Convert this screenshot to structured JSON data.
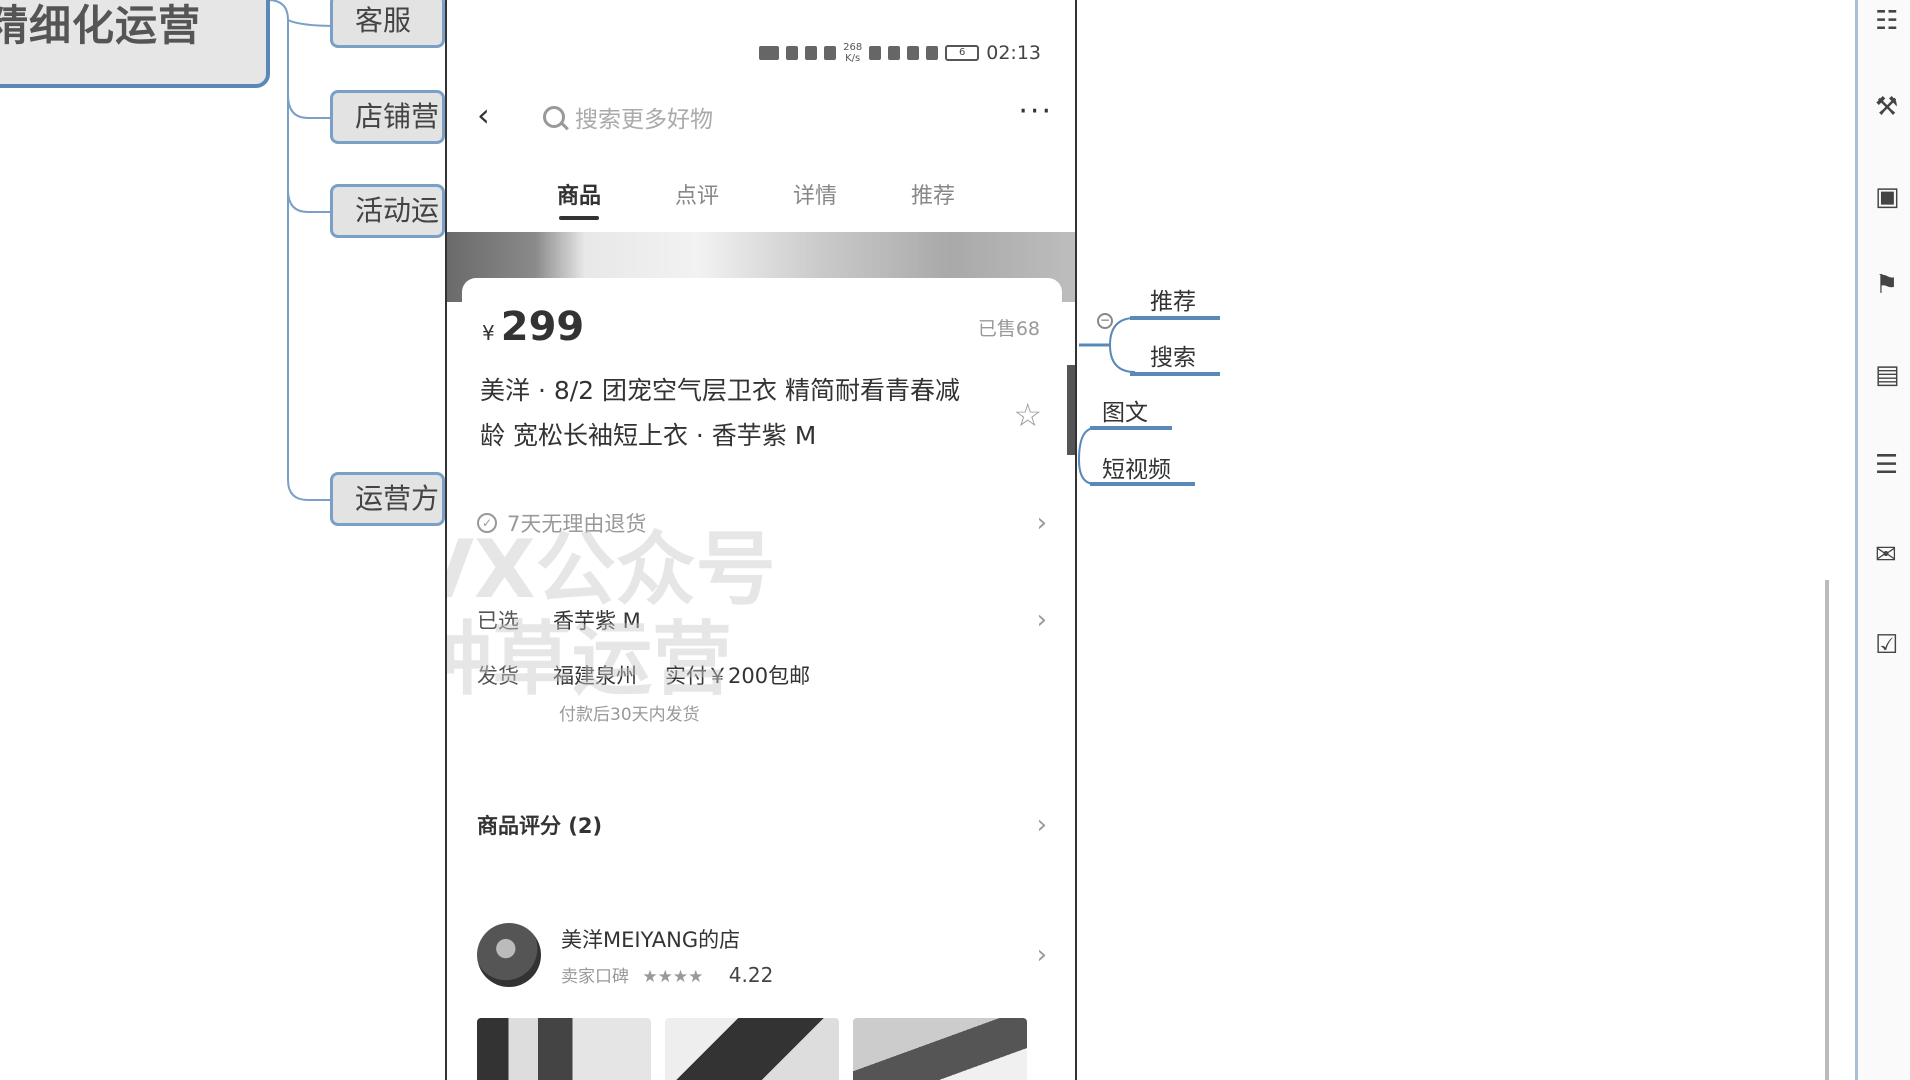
{
  "mindmap": {
    "root": "精细化运营",
    "branches": [
      "客服",
      "店铺营",
      "活动运",
      "运营方"
    ],
    "sub_items": [
      "推荐",
      "搜索",
      "图文",
      "短视频"
    ],
    "collapse_symbol": "−"
  },
  "phone": {
    "status_bar": {
      "net_speed_top": "268",
      "net_speed_unit": "K/s",
      "battery": "6",
      "time": "02:13"
    },
    "nav": {
      "back_symbol": "‹",
      "search_placeholder": "搜索更多好物",
      "more_symbol": "···"
    },
    "tabs": [
      "商品",
      "点评",
      "详情",
      "推荐"
    ],
    "product": {
      "currency": "¥",
      "price": "299",
      "sold": "已售68",
      "title": "美洋 · 8/2 团宠空气层卫衣 精简耐看青春减龄 宽松长袖短上衣 · 香芋紫 M"
    },
    "return_policy": "7天无理由退货",
    "selected_label": "已选",
    "selected_value": "香芋紫 M",
    "ship_label": "发货",
    "ship_from": "福建泉州",
    "ship_cost": "实付￥200包邮",
    "ship_note": "付款后30天内发货",
    "reviews_title": "商品评分 (2)",
    "shop": {
      "name": "美洋MEIYANG的店",
      "rating_label": "卖家口碑",
      "stars": "★★★★",
      "score": "4.22"
    },
    "watermark": "VX公众号\n种草运营"
  },
  "colors": {
    "accent": "#5a88b8",
    "node_border": "#7ba0c8",
    "node_bg": "#e3e3e3"
  }
}
